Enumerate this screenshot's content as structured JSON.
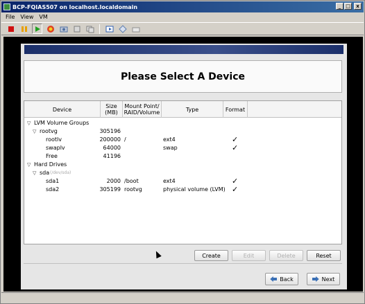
{
  "window": {
    "title": "BCP-FQIAS507 on localhost.localdomain",
    "controls": [
      "_",
      "□",
      "x"
    ]
  },
  "menu": [
    "File",
    "View",
    "VM"
  ],
  "toolbar_icons": [
    "power-off-icon",
    "pause-icon",
    "play-icon",
    "reset-icon",
    "snapshot-icon",
    "revert-snapshot-icon",
    "manage-snapshots-icon",
    "fullscreen-icon",
    "console-icon",
    "send-keys-icon"
  ],
  "installer": {
    "heading": "Please Select A Device",
    "columns": {
      "device": "Device",
      "size": "Size\n(MB)",
      "mount": "Mount Point/\nRAID/Volume",
      "type": "Type",
      "format": "Format"
    },
    "rows": [
      {
        "indent": 0,
        "expander": "▽",
        "device": "LVM Volume Groups",
        "size": "",
        "mount": "",
        "type": "",
        "format": ""
      },
      {
        "indent": 1,
        "expander": "▽",
        "device": "rootvg",
        "size": "305196",
        "mount": "",
        "type": "",
        "format": ""
      },
      {
        "indent": 2,
        "expander": "",
        "device": "rootlv",
        "size": "200000",
        "mount": "/",
        "type": "ext4",
        "format": "✓"
      },
      {
        "indent": 2,
        "expander": "",
        "device": "swaplv",
        "size": "64000",
        "mount": "",
        "type": "swap",
        "format": "✓"
      },
      {
        "indent": 2,
        "expander": "",
        "device": "Free",
        "size": "41196",
        "mount": "",
        "type": "",
        "format": ""
      },
      {
        "indent": 0,
        "expander": "▽",
        "device": "Hard Drives",
        "size": "",
        "mount": "",
        "type": "",
        "format": ""
      },
      {
        "indent": 1,
        "expander": "▽",
        "device": "sda",
        "hint": "(/dev/sda)",
        "size": "",
        "mount": "",
        "type": "",
        "format": ""
      },
      {
        "indent": 2,
        "expander": "",
        "device": "sda1",
        "size": "2000",
        "mount": "/boot",
        "type": "ext4",
        "format": "✓"
      },
      {
        "indent": 2,
        "expander": "",
        "device": "sda2",
        "size": "305199",
        "mount": "rootvg",
        "type": "physical volume (LVM)",
        "format": "✓"
      }
    ],
    "buttons": {
      "create": "Create",
      "edit": "Edit",
      "delete": "Delete",
      "reset": "Reset",
      "back": "Back",
      "next": "Next"
    }
  }
}
